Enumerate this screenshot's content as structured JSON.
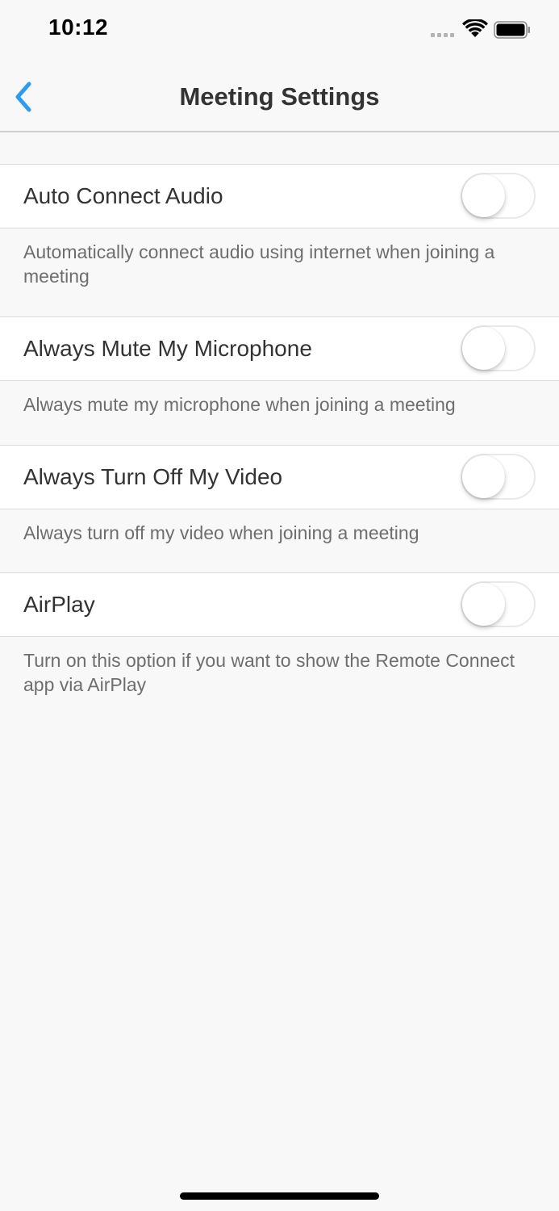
{
  "status_bar": {
    "time": "10:12"
  },
  "nav": {
    "title": "Meeting Settings",
    "accent_color": "#2d9bf0"
  },
  "settings": [
    {
      "label": "Auto Connect Audio",
      "description": "Automatically connect audio using internet when joining a meeting",
      "enabled": false
    },
    {
      "label": "Always Mute My Microphone",
      "description": "Always mute my microphone when joining a meeting",
      "enabled": false
    },
    {
      "label": "Always Turn Off My Video",
      "description": "Always turn off my video when joining a meeting",
      "enabled": false
    },
    {
      "label": "AirPlay",
      "description": "Turn on this option if you want to show the Remote Connect app via AirPlay",
      "enabled": false
    }
  ]
}
